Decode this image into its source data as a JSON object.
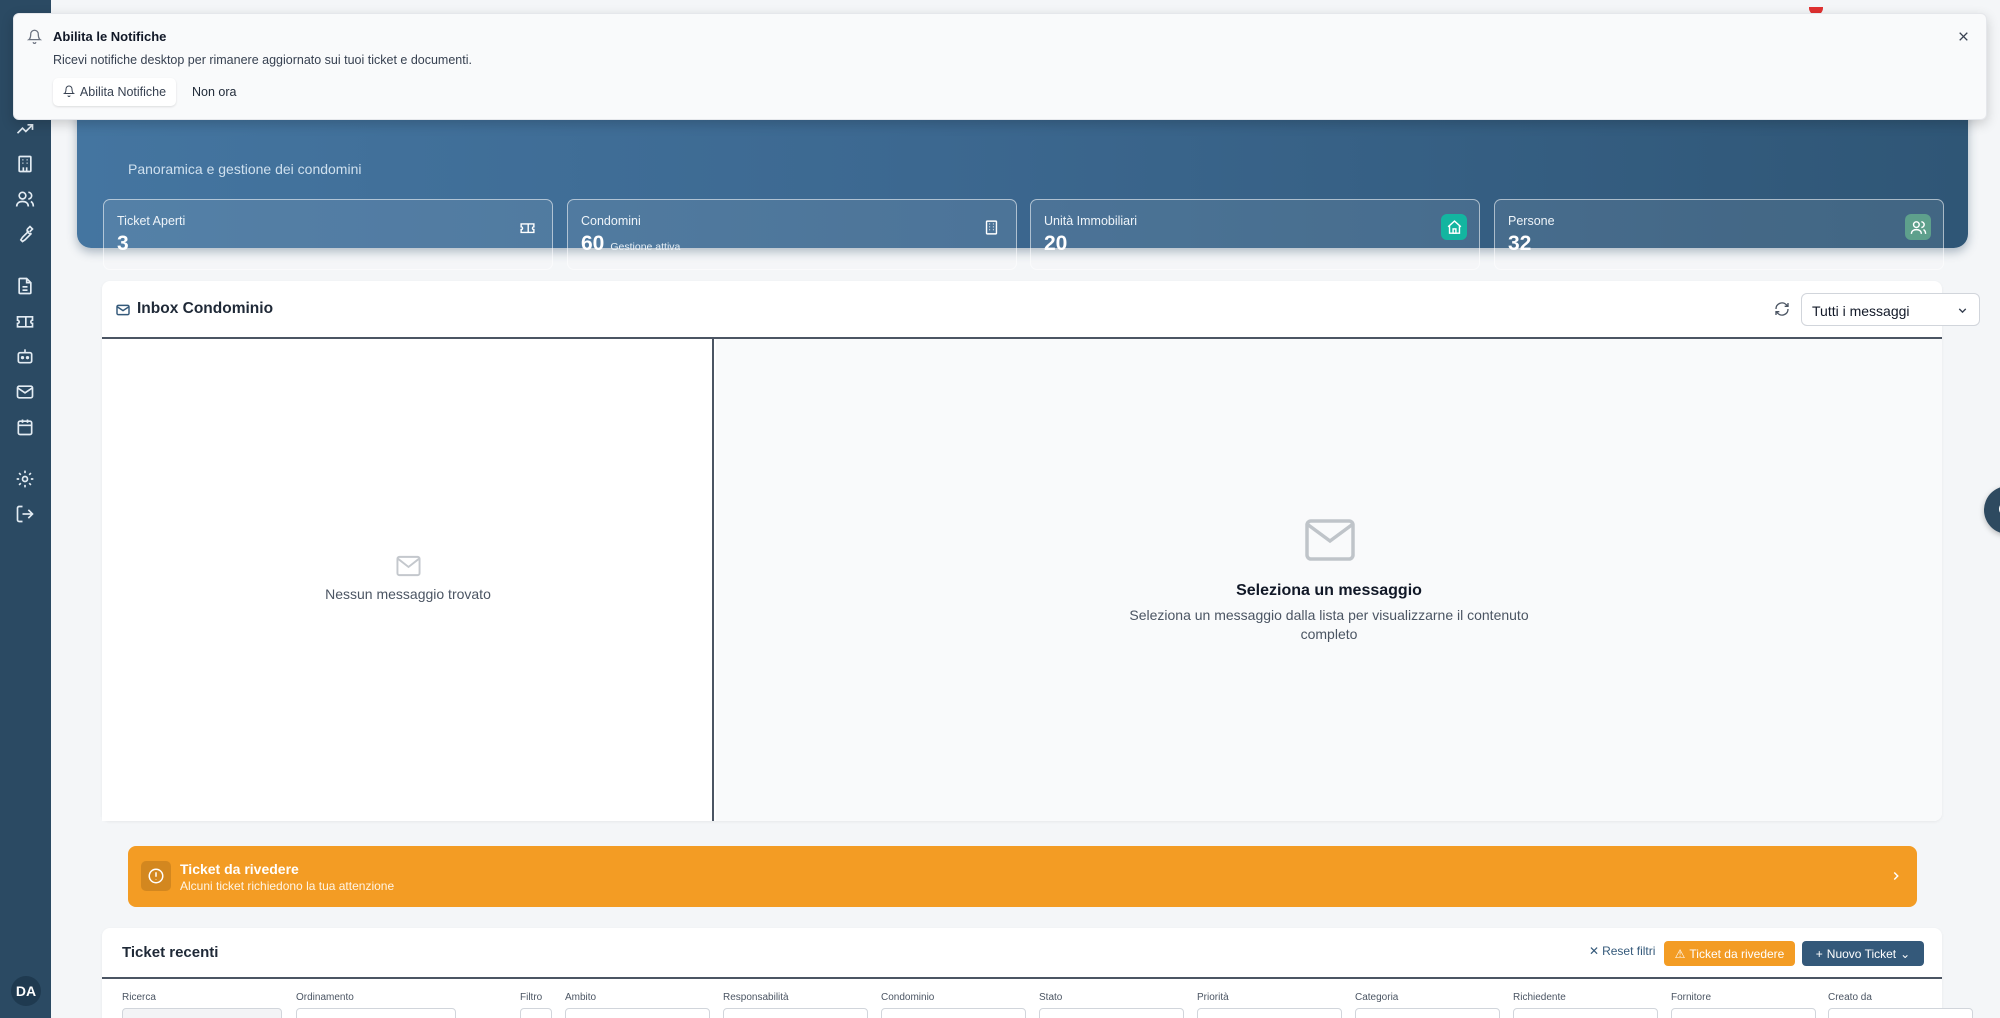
{
  "notification": {
    "title": "Abilita le Notifiche",
    "description": "Ricevi notifiche desktop per rimanere aggiornato sui tuoi ticket e documenti.",
    "enable_label": "Abilita Notifiche",
    "later_label": "Non ora"
  },
  "hero": {
    "subtitle": "Panoramica e gestione dei condomini"
  },
  "stats": [
    {
      "label": "Ticket Aperti",
      "value": "3",
      "note": "",
      "icon": "ticket-icon",
      "icon_bg": "transparent"
    },
    {
      "label": "Condomini",
      "value": "60",
      "note": "Gestione attiva",
      "icon": "building-icon",
      "icon_bg": "transparent"
    },
    {
      "label": "Unità Immobiliari",
      "value": "20",
      "note": "",
      "icon": "home-icon",
      "icon_bg": "#13b5a0"
    },
    {
      "label": "Persone",
      "value": "32",
      "note": "",
      "icon": "users-icon",
      "icon_bg": "#5ea08c"
    }
  ],
  "inbox": {
    "title": "Inbox Condominio",
    "filter_value": "Tutti i messaggi",
    "empty_list": "Nessun messaggio trovato",
    "detail_title": "Seleziona un messaggio",
    "detail_desc": "Seleziona un messaggio dalla lista per visualizzarne il contenuto completo"
  },
  "alert": {
    "title": "Ticket da rivedere",
    "subtitle": "Alcuni ticket richiedono la tua attenzione"
  },
  "tickets": {
    "title": "Ticket recenti",
    "reset_label": "Reset filtri",
    "review_label": "Ticket da rivedere",
    "new_label": "Nuovo Ticket",
    "filters": [
      "Ricerca",
      "Ordinamento",
      "Filtro",
      "Ambito",
      "Responsabilità",
      "Condominio",
      "Stato",
      "Priorità",
      "Categoria",
      "Richiedente",
      "Fornitore",
      "Creato da"
    ]
  },
  "user": {
    "initials": "DA"
  },
  "colors": {
    "sidebar": "#2b4a63",
    "accent": "#34597a",
    "warning": "#f39c24"
  }
}
